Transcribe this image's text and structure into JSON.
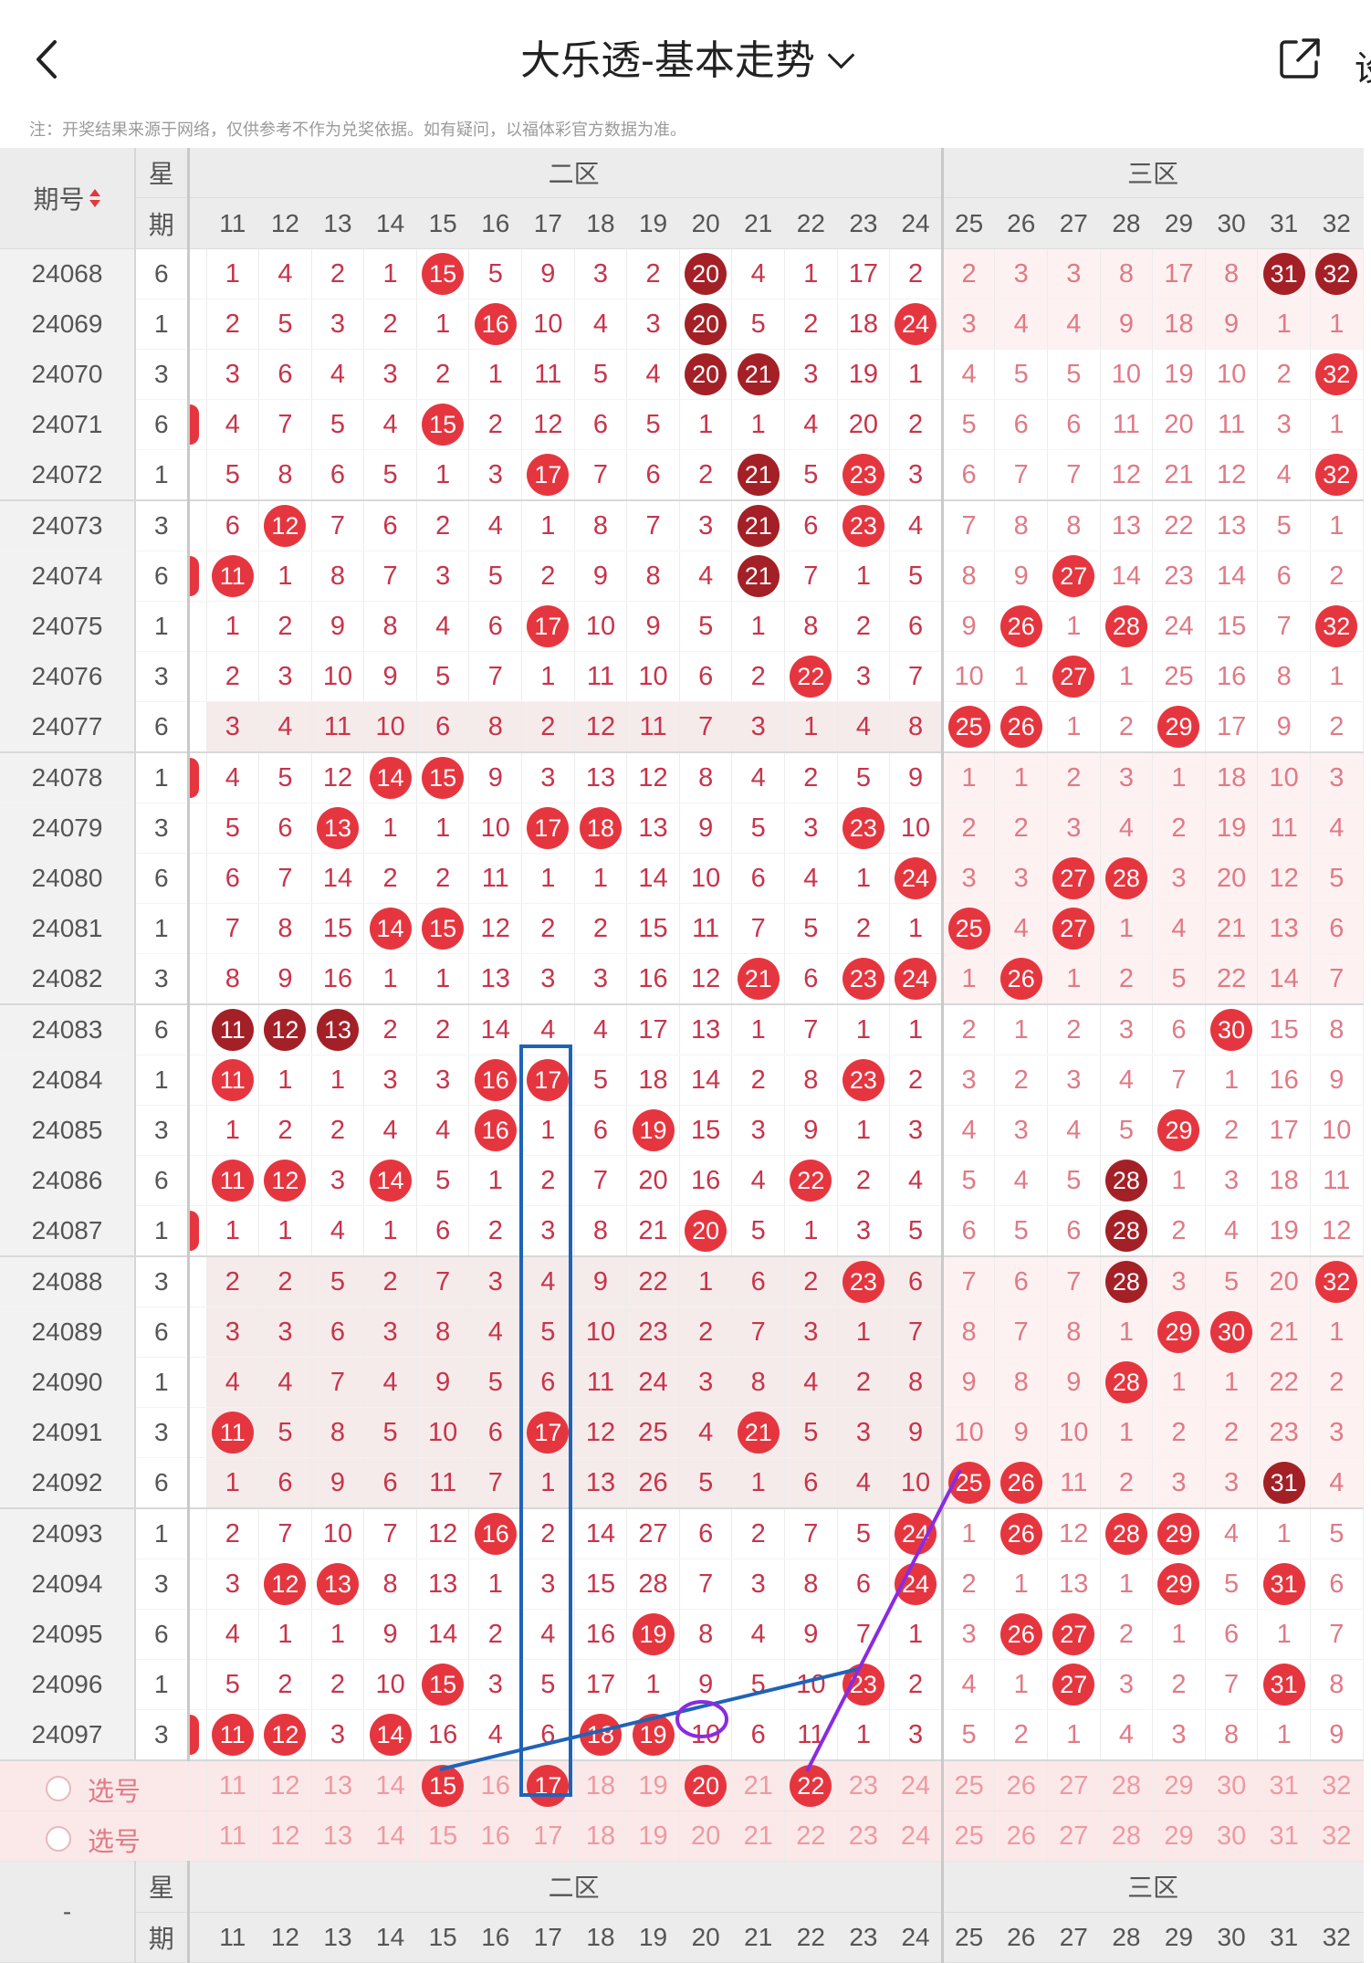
{
  "header": {
    "title": "大乐透-基本走势",
    "settings_peek": "设"
  },
  "note": "注：开奖结果来源于网络，仅供参考不作为兑奖依据。如有疑问，以福体彩官方数据为准。",
  "table": {
    "col_qi": "期号",
    "col_day_top": "星",
    "col_day_bottom": "期",
    "zone2_label": "二区",
    "zone3_label": "三区",
    "numbers": [
      "11",
      "12",
      "13",
      "14",
      "15",
      "16",
      "17",
      "18",
      "19",
      "20",
      "21",
      "22",
      "23",
      "24",
      "25",
      "26",
      "27",
      "28",
      "29",
      "30",
      "31",
      "32"
    ],
    "rows": [
      {
        "qi": "24068",
        "day": "6",
        "cut": "",
        "v": [
          "1",
          "4",
          "2",
          "1",
          "15",
          "5",
          "9",
          "3",
          "2",
          "20",
          "4",
          "1",
          "17",
          "2",
          "2",
          "3",
          "3",
          "8",
          "17",
          "8",
          "31",
          "32"
        ]
      },
      {
        "qi": "24069",
        "day": "1",
        "cut": "",
        "v": [
          "2",
          "5",
          "3",
          "2",
          "1",
          "16",
          "10",
          "4",
          "3",
          "20",
          "5",
          "2",
          "18",
          "24",
          "3",
          "4",
          "4",
          "9",
          "18",
          "9",
          "1",
          "1"
        ]
      },
      {
        "qi": "24070",
        "day": "3",
        "cut": "",
        "v": [
          "3",
          "6",
          "4",
          "3",
          "2",
          "1",
          "11",
          "5",
          "4",
          "20",
          "21",
          "3",
          "19",
          "1",
          "4",
          "5",
          "5",
          "10",
          "19",
          "10",
          "2",
          "32"
        ]
      },
      {
        "qi": "24071",
        "day": "6",
        "cut": "●",
        "v": [
          "4",
          "7",
          "5",
          "4",
          "15",
          "2",
          "12",
          "6",
          "5",
          "1",
          "1",
          "4",
          "20",
          "2",
          "5",
          "6",
          "6",
          "11",
          "20",
          "11",
          "3",
          "1"
        ]
      },
      {
        "qi": "24072",
        "day": "1",
        "cut": "",
        "v": [
          "5",
          "8",
          "6",
          "5",
          "1",
          "3",
          "17",
          "7",
          "6",
          "2",
          "21",
          "5",
          "23",
          "3",
          "6",
          "7",
          "7",
          "12",
          "21",
          "12",
          "4",
          "32"
        ]
      },
      {
        "qi": "24073",
        "day": "3",
        "cut": "",
        "v": [
          "6",
          "12",
          "7",
          "6",
          "2",
          "4",
          "1",
          "8",
          "7",
          "3",
          "21",
          "6",
          "23",
          "4",
          "7",
          "8",
          "8",
          "13",
          "22",
          "13",
          "5",
          "1"
        ]
      },
      {
        "qi": "24074",
        "day": "6",
        "cut": "●",
        "v": [
          "11",
          "1",
          "8",
          "7",
          "3",
          "5",
          "2",
          "9",
          "8",
          "4",
          "21",
          "7",
          "1",
          "5",
          "8",
          "9",
          "27",
          "14",
          "23",
          "14",
          "6",
          "2"
        ]
      },
      {
        "qi": "24075",
        "day": "1",
        "cut": "",
        "v": [
          "1",
          "2",
          "9",
          "8",
          "4",
          "6",
          "17",
          "10",
          "9",
          "5",
          "1",
          "8",
          "2",
          "6",
          "9",
          "26",
          "1",
          "28",
          "24",
          "15",
          "7",
          "32"
        ]
      },
      {
        "qi": "24076",
        "day": "3",
        "cut": "",
        "v": [
          "2",
          "3",
          "10",
          "9",
          "5",
          "7",
          "1",
          "11",
          "10",
          "6",
          "2",
          "22",
          "3",
          "7",
          "10",
          "1",
          "27",
          "1",
          "25",
          "16",
          "8",
          "1"
        ]
      },
      {
        "qi": "24077",
        "day": "6",
        "cut": "",
        "v": [
          "3",
          "4",
          "11",
          "10",
          "6",
          "8",
          "2",
          "12",
          "11",
          "7",
          "3",
          "1",
          "4",
          "8",
          "25",
          "26",
          "1",
          "2",
          "29",
          "17",
          "9",
          "2"
        ]
      },
      {
        "qi": "24078",
        "day": "1",
        "cut": "●",
        "v": [
          "4",
          "5",
          "12",
          "14",
          "15",
          "9",
          "3",
          "13",
          "12",
          "8",
          "4",
          "2",
          "5",
          "9",
          "1",
          "1",
          "2",
          "3",
          "1",
          "18",
          "10",
          "3"
        ]
      },
      {
        "qi": "24079",
        "day": "3",
        "cut": "",
        "v": [
          "5",
          "6",
          "13",
          "1",
          "1",
          "10",
          "17",
          "18",
          "13",
          "9",
          "5",
          "3",
          "23",
          "10",
          "2",
          "2",
          "3",
          "4",
          "2",
          "19",
          "11",
          "4"
        ]
      },
      {
        "qi": "24080",
        "day": "6",
        "cut": "",
        "v": [
          "6",
          "7",
          "14",
          "2",
          "2",
          "11",
          "1",
          "1",
          "14",
          "10",
          "6",
          "4",
          "1",
          "24",
          "3",
          "3",
          "27",
          "28",
          "3",
          "20",
          "12",
          "5"
        ]
      },
      {
        "qi": "24081",
        "day": "1",
        "cut": "",
        "v": [
          "7",
          "8",
          "15",
          "14",
          "15",
          "12",
          "2",
          "2",
          "15",
          "11",
          "7",
          "5",
          "2",
          "1",
          "25",
          "4",
          "27",
          "1",
          "4",
          "21",
          "13",
          "6"
        ]
      },
      {
        "qi": "24082",
        "day": "3",
        "cut": "",
        "v": [
          "8",
          "9",
          "16",
          "1",
          "1",
          "13",
          "3",
          "3",
          "16",
          "12",
          "21",
          "6",
          "23",
          "24",
          "1",
          "26",
          "1",
          "2",
          "5",
          "22",
          "14",
          "7"
        ]
      },
      {
        "qi": "24083",
        "day": "6",
        "cut": "",
        "v": [
          "11",
          "12",
          "13",
          "2",
          "2",
          "14",
          "4",
          "4",
          "17",
          "13",
          "1",
          "7",
          "1",
          "1",
          "2",
          "1",
          "2",
          "3",
          "6",
          "30",
          "15",
          "8"
        ]
      },
      {
        "qi": "24084",
        "day": "1",
        "cut": "",
        "v": [
          "11",
          "1",
          "1",
          "3",
          "3",
          "16",
          "17",
          "5",
          "18",
          "14",
          "2",
          "8",
          "23",
          "2",
          "3",
          "2",
          "3",
          "4",
          "7",
          "1",
          "16",
          "9"
        ]
      },
      {
        "qi": "24085",
        "day": "3",
        "cut": "",
        "v": [
          "1",
          "2",
          "2",
          "4",
          "4",
          "16",
          "1",
          "6",
          "19",
          "15",
          "3",
          "9",
          "1",
          "3",
          "4",
          "3",
          "4",
          "5",
          "29",
          "2",
          "17",
          "10"
        ]
      },
      {
        "qi": "24086",
        "day": "6",
        "cut": "",
        "v": [
          "11",
          "12",
          "3",
          "14",
          "5",
          "1",
          "2",
          "7",
          "20",
          "16",
          "4",
          "22",
          "2",
          "4",
          "5",
          "4",
          "5",
          "28",
          "1",
          "3",
          "18",
          "11"
        ]
      },
      {
        "qi": "24087",
        "day": "1",
        "cut": "●",
        "v": [
          "1",
          "1",
          "4",
          "1",
          "6",
          "2",
          "3",
          "8",
          "21",
          "20",
          "5",
          "1",
          "3",
          "5",
          "6",
          "5",
          "6",
          "28",
          "2",
          "4",
          "19",
          "12"
        ]
      },
      {
        "qi": "24088",
        "day": "3",
        "cut": "",
        "v": [
          "2",
          "2",
          "5",
          "2",
          "7",
          "3",
          "4",
          "9",
          "22",
          "1",
          "6",
          "2",
          "23",
          "6",
          "7",
          "6",
          "7",
          "28",
          "3",
          "5",
          "20",
          "32"
        ]
      },
      {
        "qi": "24089",
        "day": "6",
        "cut": "",
        "v": [
          "3",
          "3",
          "6",
          "3",
          "8",
          "4",
          "5",
          "10",
          "23",
          "2",
          "7",
          "3",
          "1",
          "7",
          "8",
          "7",
          "8",
          "1",
          "29",
          "30",
          "21",
          "1"
        ]
      },
      {
        "qi": "24090",
        "day": "1",
        "cut": "",
        "v": [
          "4",
          "4",
          "7",
          "4",
          "9",
          "5",
          "6",
          "11",
          "24",
          "3",
          "8",
          "4",
          "2",
          "8",
          "9",
          "8",
          "9",
          "28",
          "1",
          "1",
          "22",
          "2"
        ]
      },
      {
        "qi": "24091",
        "day": "3",
        "cut": "",
        "v": [
          "11",
          "5",
          "8",
          "5",
          "10",
          "6",
          "17",
          "12",
          "25",
          "4",
          "21",
          "5",
          "3",
          "9",
          "10",
          "9",
          "10",
          "1",
          "2",
          "2",
          "23",
          "3"
        ]
      },
      {
        "qi": "24092",
        "day": "6",
        "cut": "",
        "v": [
          "1",
          "6",
          "9",
          "6",
          "11",
          "7",
          "1",
          "13",
          "26",
          "5",
          "1",
          "6",
          "4",
          "10",
          "25",
          "26",
          "11",
          "2",
          "3",
          "3",
          "31",
          "4"
        ]
      },
      {
        "qi": "24093",
        "day": "1",
        "cut": "",
        "v": [
          "2",
          "7",
          "10",
          "7",
          "12",
          "16",
          "2",
          "14",
          "27",
          "6",
          "2",
          "7",
          "5",
          "24",
          "1",
          "26",
          "12",
          "28",
          "29",
          "4",
          "1",
          "5"
        ]
      },
      {
        "qi": "24094",
        "day": "3",
        "cut": "",
        "v": [
          "3",
          "12",
          "13",
          "8",
          "13",
          "1",
          "3",
          "15",
          "28",
          "7",
          "3",
          "8",
          "6",
          "24",
          "2",
          "1",
          "13",
          "1",
          "29",
          "5",
          "31",
          "6"
        ]
      },
      {
        "qi": "24095",
        "day": "6",
        "cut": "",
        "v": [
          "4",
          "1",
          "1",
          "9",
          "14",
          "2",
          "4",
          "16",
          "19",
          "8",
          "4",
          "9",
          "7",
          "1",
          "3",
          "26",
          "27",
          "2",
          "1",
          "6",
          "1",
          "7"
        ]
      },
      {
        "qi": "24096",
        "day": "1",
        "cut": "",
        "v": [
          "5",
          "2",
          "2",
          "10",
          "15",
          "3",
          "5",
          "17",
          "1",
          "9",
          "5",
          "10",
          "23",
          "2",
          "4",
          "1",
          "27",
          "3",
          "2",
          "7",
          "31",
          "8"
        ]
      },
      {
        "qi": "24097",
        "day": "3",
        "cut": "●",
        "v": [
          "11",
          "12",
          "3",
          "14",
          "16",
          "4",
          "6",
          "18",
          "19",
          "10",
          "6",
          "11",
          "1",
          "3",
          "5",
          "2",
          "1",
          "4",
          "3",
          "8",
          "1",
          "9"
        ]
      }
    ],
    "pick_label": "选号",
    "pick_selected": [
      "15",
      "17",
      "20",
      "22"
    ]
  }
}
